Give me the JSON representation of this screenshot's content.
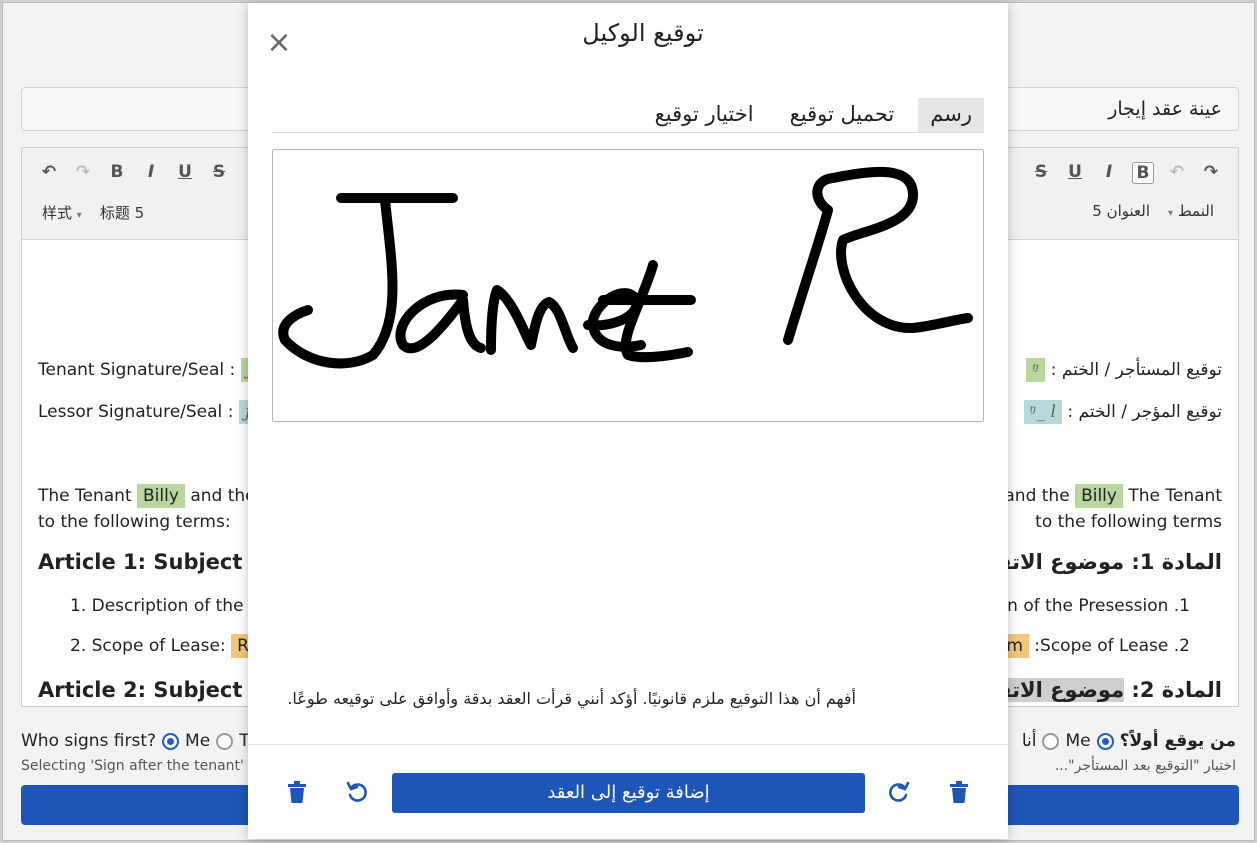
{
  "doc_title": "عينة عقد إيجار",
  "toolbar": {
    "left_icons": {
      "undo": "↶",
      "redo": "↷",
      "bold": "B",
      "italic": "I",
      "underline": "U",
      "strike": "S"
    },
    "right_icons": {
      "strike": "S",
      "underline": "U",
      "italic": "I",
      "bold": "B",
      "undo": "↶",
      "redo": "↷"
    },
    "left_style": "样式",
    "left_heading": "标题 5",
    "right_style": "النمط",
    "right_heading": "العنوان 5",
    "arrow": "▾"
  },
  "document": {
    "ltr": {
      "tenant_sig_label": "Tenant Signature/Seal",
      "lessor_sig_label": "Lessor Signature/Seal",
      "colon": ":",
      "mini_sig": "ɲ_",
      "line1_a": "The Tenant",
      "line1_name": "Billy",
      "line1_b": "and the Le",
      "line2": "to the following terms:",
      "article1": "Article 1: Subject Mat",
      "item1": "1. Description of the Pre",
      "item2_label": "2. Scope of Lease:",
      "item2_value": "Roor",
      "article2": "Article 2: Subject Mat"
    },
    "rtl": {
      "tenant_sig_label": "توقيع المستأجر / الختم :",
      "lessor_sig_label": "توقيع المؤجر / الختم :",
      "mini_sig_tenant": "ᵑ",
      "mini_sig_lessor": "ᵑ_ l",
      "line1_a": "The Tenant",
      "line1_name": "Billy",
      "line1_b": "and the",
      "line1_c": "ب",
      "line2": "to the following terms",
      "article1": "المادة 1: موضوع الاتفس",
      "item1": "tion of the Presession .1",
      "item2_label": ":Scope of Lease .2",
      "item2_value": "ooom",
      "article2_a": "المادة 2: ",
      "article2_b": "موضوع الاتفس"
    }
  },
  "signs_first": {
    "label": "Who signs first?",
    "opt_me": "Me",
    "opt_other": "Th",
    "hint": "Selecting 'Sign after the tenant' en",
    "label_ar": "من يوقع أولاً؟",
    "opt_me_ar": "Me",
    "opt_other_ar": "أنا",
    "hint_ar": "اختيار \"التوقيع بعد المستأجر\"..."
  },
  "modal": {
    "title": "توقيع الوكيل",
    "close": "×",
    "tabs": [
      {
        "label": "رسم",
        "active": true
      },
      {
        "label": "تحميل توقيع",
        "active": false
      },
      {
        "label": "اختيار توقيع",
        "active": false
      }
    ],
    "consent": "أفهم أن هذا التوقيع ملزم قانونيًا. أؤكد أنني قرأت العقد بدقة وأوافق على توقيعه طوعًا.",
    "add_button": "إضافة توقيع إلى العقد"
  },
  "colors": {
    "accent": "#1e56b8",
    "tenant_highlight": "#b9d6a0",
    "lessor_highlight": "#b8d8dc",
    "scope_highlight": "#f0c77a"
  }
}
